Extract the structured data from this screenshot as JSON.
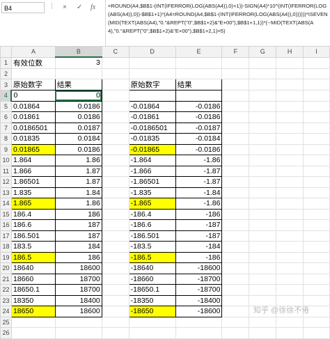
{
  "namebox": "B4",
  "formula_buttons": {
    "cancel": "×",
    "enter": "✓",
    "fx": "fx"
  },
  "formula": "=ROUND(A4,$B$1-(INT(IFERROR(LOG(ABS(A4)),0)+1))-SIGN(A4)*10^(INT(IFERROR(LOG(ABS(A4)),0))-$B$1+1)*(A4=ROUND(A4,$B$1-(INT(IFERROR(LOG(ABS(A4)),0))))))*ISEVEN(MID(TEXT(ABS(A4),\"0.\"&REPT(\"0\",$B$1+2)&\"E+00\"),$B$1+1,1))*(--MID(TEXT(ABS(A4),\"0.\"&REPT(\"0\",$B$1+2)&\"E+00\"),$B$1+2,1)=5)",
  "columns": [
    "A",
    "B",
    "C",
    "D",
    "E",
    "F",
    "G",
    "H",
    "I"
  ],
  "rows": [
    {
      "n": "1",
      "a": "有效位数",
      "b": "3",
      "d": "",
      "e": ""
    },
    {
      "n": "2",
      "a": "",
      "b": "",
      "d": "",
      "e": ""
    },
    {
      "n": "3",
      "a": "原始数字",
      "b": "结果",
      "d": "原始数字",
      "e": "结果"
    },
    {
      "n": "4",
      "a": "0",
      "b": "0",
      "d": "",
      "e": ""
    },
    {
      "n": "5",
      "a": "0.01864",
      "b": "0.0186",
      "d": "-0.01864",
      "e": "-0.0186"
    },
    {
      "n": "6",
      "a": "0.01861",
      "b": "0.0186",
      "d": "-0.01861",
      "e": "-0.0186"
    },
    {
      "n": "7",
      "a": "0.0186501",
      "b": "0.0187",
      "d": "-0.0186501",
      "e": "-0.0187"
    },
    {
      "n": "8",
      "a": "0.01835",
      "b": "0.0184",
      "d": "-0.01835",
      "e": "-0.0184"
    },
    {
      "n": "9",
      "a": "0.01865",
      "b": "0.0186",
      "d": "-0.01865",
      "e": "-0.0186",
      "hl": true
    },
    {
      "n": "10",
      "a": "1.864",
      "b": "1.86",
      "d": "-1.864",
      "e": "-1.86"
    },
    {
      "n": "11",
      "a": "1.866",
      "b": "1.87",
      "d": "-1.866",
      "e": "-1.87"
    },
    {
      "n": "12",
      "a": "1.86501",
      "b": "1.87",
      "d": "-1.86501",
      "e": "-1.87"
    },
    {
      "n": "13",
      "a": "1.835",
      "b": "1.84",
      "d": "-1.835",
      "e": "-1.84"
    },
    {
      "n": "14",
      "a": "1.865",
      "b": "1.86",
      "d": "-1.865",
      "e": "-1.86",
      "hl": true
    },
    {
      "n": "15",
      "a": "186.4",
      "b": "186",
      "d": "-186.4",
      "e": "-186"
    },
    {
      "n": "16",
      "a": "186.6",
      "b": "187",
      "d": "-186.6",
      "e": "-187"
    },
    {
      "n": "17",
      "a": "186.501",
      "b": "187",
      "d": "-186.501",
      "e": "-187"
    },
    {
      "n": "18",
      "a": "183.5",
      "b": "184",
      "d": "-183.5",
      "e": "-184"
    },
    {
      "n": "19",
      "a": "186.5",
      "b": "186",
      "d": "-186.5",
      "e": "-186",
      "hl": true
    },
    {
      "n": "20",
      "a": "18640",
      "b": "18600",
      "d": "-18640",
      "e": "-18600"
    },
    {
      "n": "21",
      "a": "18660",
      "b": "18700",
      "d": "-18660",
      "e": "-18700"
    },
    {
      "n": "22",
      "a": "18650.1",
      "b": "18700",
      "d": "-18650.1",
      "e": "-18700"
    },
    {
      "n": "23",
      "a": "18350",
      "b": "18400",
      "d": "-18350",
      "e": "-18400"
    },
    {
      "n": "24",
      "a": "18650",
      "b": "18600",
      "d": "-18650",
      "e": "-18600",
      "hl": true
    },
    {
      "n": "25",
      "a": "",
      "b": "",
      "d": "",
      "e": ""
    },
    {
      "n": "26",
      "a": "",
      "b": "",
      "d": "",
      "e": ""
    }
  ],
  "watermark": "知乎 @徐徐不倦",
  "colors": {
    "highlight": "#ffff00",
    "select": "#217346"
  }
}
